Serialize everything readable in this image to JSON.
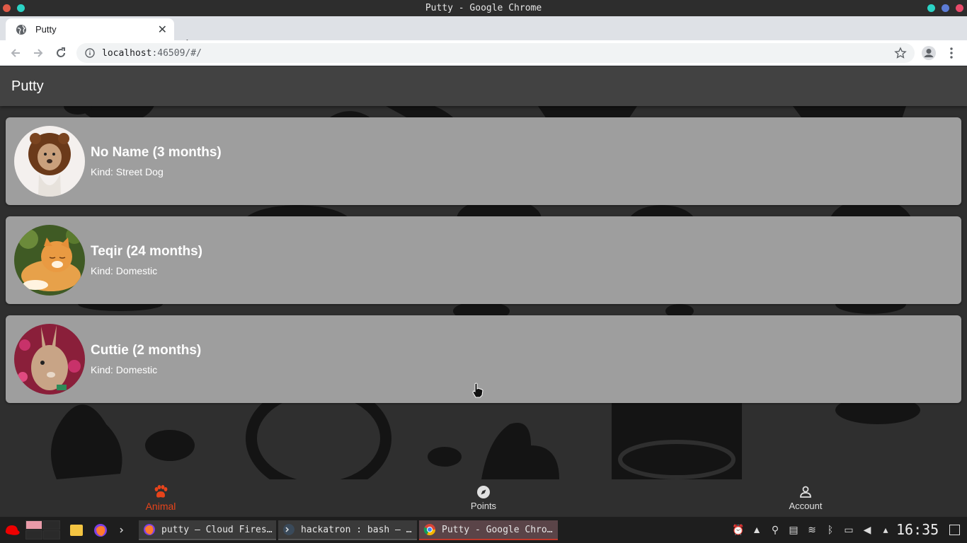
{
  "window": {
    "title": "Putty - Google Chrome",
    "dot_colors": [
      "#e05a47",
      "#2bd3c5"
    ]
  },
  "browser": {
    "tab_title": "Putty",
    "url_host": "localhost",
    "url_path": ":46509/#/"
  },
  "app": {
    "title": "Putty",
    "animals": [
      {
        "name": "No Name (3 months)",
        "kind": "Kind: Street Dog",
        "avatar": "lion-costume-dog"
      },
      {
        "name": "Teqir (24 months)",
        "kind": "Kind: Domestic",
        "avatar": "orange-cat"
      },
      {
        "name": "Cuttie (2 months)",
        "kind": "Kind: Domestic",
        "avatar": "rabbit"
      }
    ],
    "nav": [
      {
        "label": "Animal",
        "icon": "paw-icon",
        "active": true
      },
      {
        "label": "Points",
        "icon": "compass-icon",
        "active": false
      },
      {
        "label": "Account",
        "icon": "person-icon",
        "active": false
      }
    ],
    "accent": "#e8441b"
  },
  "taskbar": {
    "tasks": [
      {
        "label": "putty – Cloud Fires…",
        "icon": "firefox-icon"
      },
      {
        "label": "hackatron : bash — …",
        "icon": "terminal-icon"
      },
      {
        "label": "Putty - Google Chro…",
        "icon": "chrome-icon"
      }
    ],
    "clock": "16:35"
  }
}
